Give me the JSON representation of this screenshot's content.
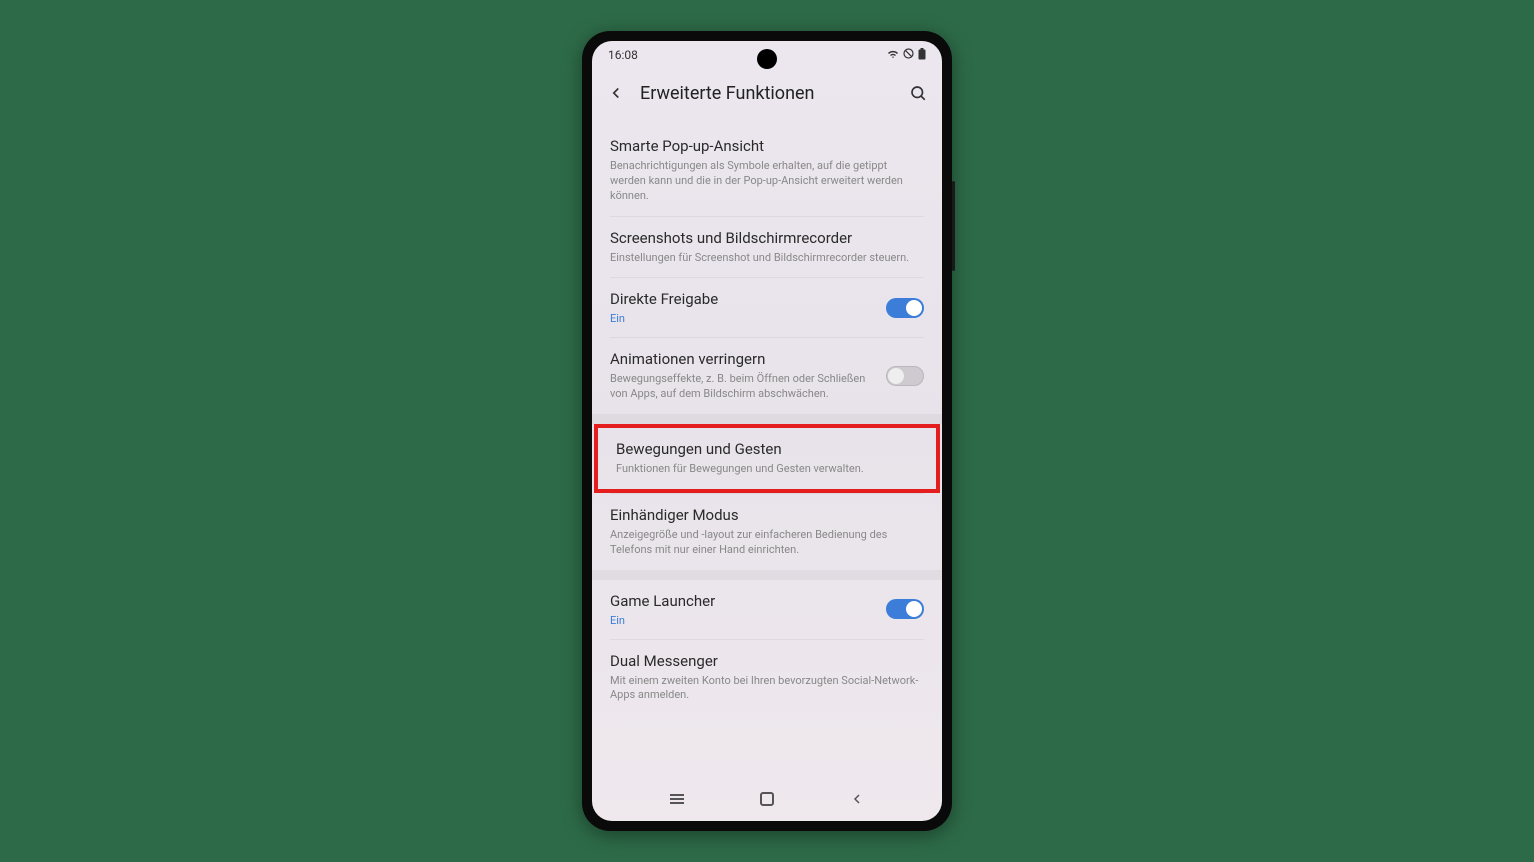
{
  "statusBar": {
    "time": "16:08"
  },
  "header": {
    "title": "Erweiterte Funktionen"
  },
  "settings": {
    "popup": {
      "title": "Smarte Pop-up-Ansicht",
      "desc": "Benachrichtigungen als Symbole erhalten, auf die getippt werden kann und die in der Pop-up-Ansicht erweitert werden können."
    },
    "screenshots": {
      "title": "Screenshots und Bildschirmrecorder",
      "desc": "Einstellungen für Screenshot und Bildschirmrecorder steuern."
    },
    "directShare": {
      "title": "Direkte Freigabe",
      "status": "Ein"
    },
    "reduceAnimations": {
      "title": "Animationen verringern",
      "desc": "Bewegungseffekte, z. B. beim Öffnen oder Schließen von Apps, auf dem Bildschirm abschwächen."
    },
    "motions": {
      "title": "Bewegungen und Gesten",
      "desc": "Funktionen für Bewegungen und Gesten verwalten."
    },
    "oneHanded": {
      "title": "Einhändiger Modus",
      "desc": "Anzeigegröße und -layout zur einfacheren Bedienung des Telefons mit nur einer Hand einrichten."
    },
    "gameLauncher": {
      "title": "Game Launcher",
      "status": "Ein"
    },
    "dualMessenger": {
      "title": "Dual Messenger",
      "desc": "Mit einem zweiten Konto bei Ihren bevorzugten Social-Network-Apps anmelden."
    }
  }
}
